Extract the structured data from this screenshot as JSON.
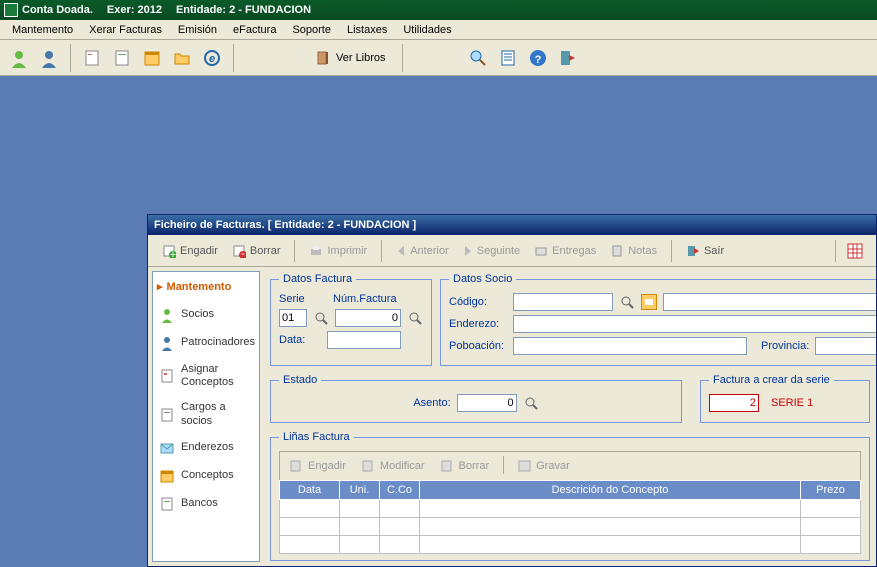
{
  "title": {
    "app": "Conta Doada.",
    "exer": "Exer: 2012",
    "entidade": "Entidade: 2 - FUNDACION"
  },
  "menu": {
    "m1": "Mantemento",
    "m2": "Xerar Facturas",
    "m3": "Emisión",
    "m4": "eFactura",
    "m5": "Soporte",
    "m6": "Listaxes",
    "m7": "Utilidades"
  },
  "maintb": {
    "verlibros": "Ver Libros"
  },
  "child": {
    "title": "Ficheiro de Facturas. [ Entidade: 2 - FUNDACION ]",
    "tb": {
      "engadir": "Engadir",
      "borrar": "Borrar",
      "imprimir": "Imprimir",
      "anterior": "Anterior",
      "seguinte": "Seguinte",
      "entregas": "Entregas",
      "notas": "Notas",
      "sair": "Saír"
    },
    "nav": {
      "hdr": "Mantemento",
      "socios": "Socios",
      "patro": "Patrocinadores",
      "asignar": "Asignar Conceptos",
      "cargos": "Cargos a socios",
      "enderezos": "Enderezos",
      "conceptos": "Conceptos",
      "bancos": "Bancos"
    },
    "datosfact": {
      "legend": "Datos Factura",
      "serie_lbl": "Serie",
      "num_lbl": "Núm.Factura",
      "data_lbl": "Data:",
      "serie_val": "01",
      "num_val": "0",
      "data_val": ""
    },
    "datossocio": {
      "legend": "Datos Socio",
      "codigo_lbl": "Código:",
      "enderezo_lbl": "Enderezo:",
      "poboacion_lbl": "Poboación:",
      "provincia_lbl": "Provincia:",
      "codigo_val": "",
      "nome_val": "",
      "enderezo_val": "",
      "poboacion_val": "",
      "provincia_val": ""
    },
    "estado": {
      "legend": "Estado",
      "asento_lbl": "Asento:",
      "asento_val": "0"
    },
    "crear": {
      "legend": "Factura a crear da serie",
      "val": "2",
      "serie": "SERIE 1"
    },
    "linas": {
      "legend": "Liñas Factura",
      "engadir": "Engadir",
      "modificar": "Modificar",
      "borrar": "Borrar",
      "gravar": "Gravar",
      "cols": {
        "data": "Data",
        "uni": "Uni.",
        "cco": "C.Co",
        "desc": "Descrición do Concepto",
        "prezo": "Prezo"
      }
    }
  }
}
